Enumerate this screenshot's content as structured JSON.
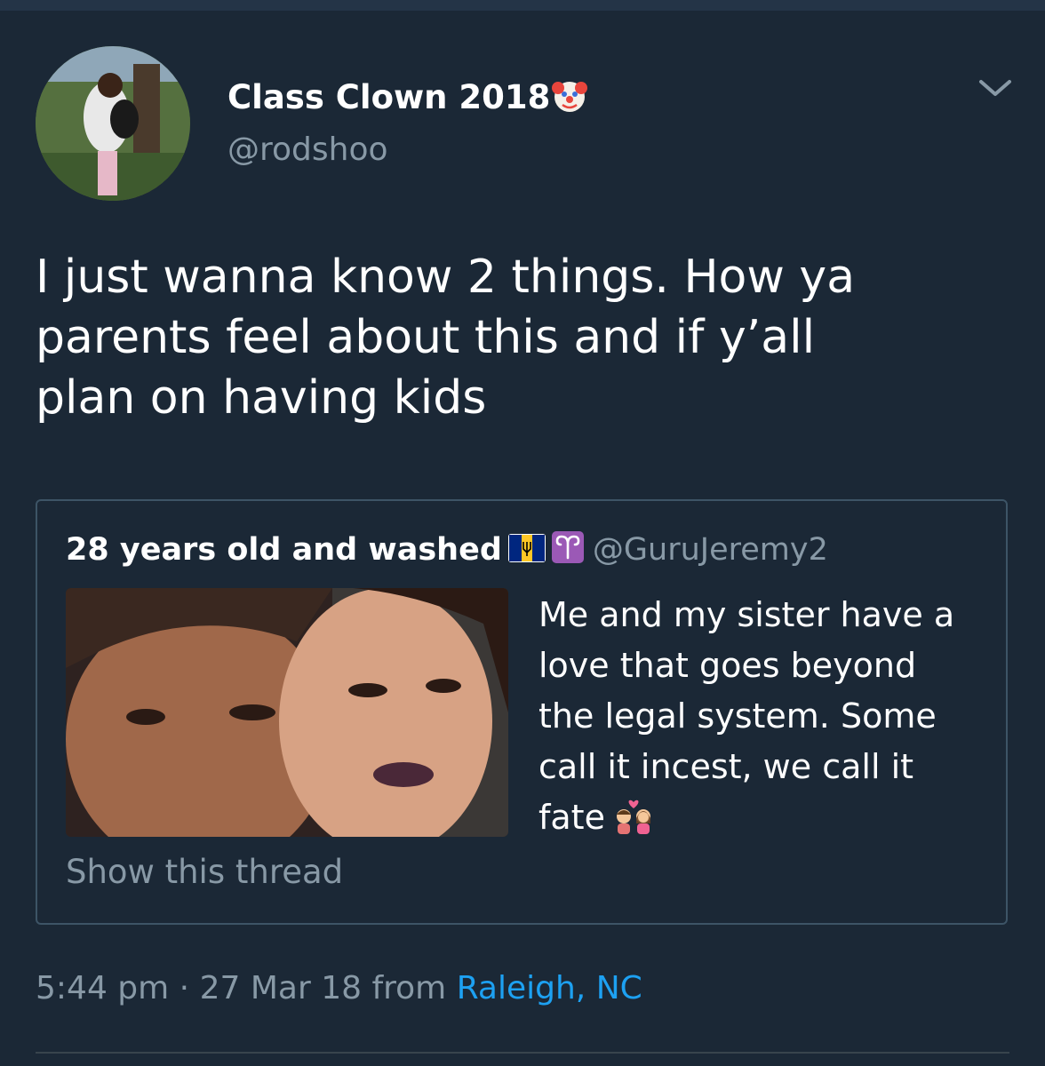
{
  "tweet": {
    "display_name": "Class Clown 2018",
    "display_name_emoji": "clown-face-icon",
    "handle": "@rodshoo",
    "text": "I just wanna know 2 things. How ya\nparents feel about this and if y’all\nplan on having kids"
  },
  "quoted_tweet": {
    "display_name": "28 years old and washed",
    "name_icons": [
      "barbados-flag-icon",
      "aries-sign-icon"
    ],
    "handle": "@GuruJeremy2",
    "text": "Me and my sister have a\nlove that goes beyond\nthe legal system. Some\ncall it incest, we call it\nfate",
    "text_emoji": "couple-with-heart-icon",
    "show_thread": "Show this thread"
  },
  "meta": {
    "time": "5:44 pm",
    "separator": "·",
    "date": "27 Mar 18",
    "from_label": "from",
    "location": "Raleigh, NC"
  },
  "colors": {
    "background": "#1b2836",
    "secondary_text": "#8899a6",
    "link": "#1da1f2",
    "border": "#3d5466"
  }
}
